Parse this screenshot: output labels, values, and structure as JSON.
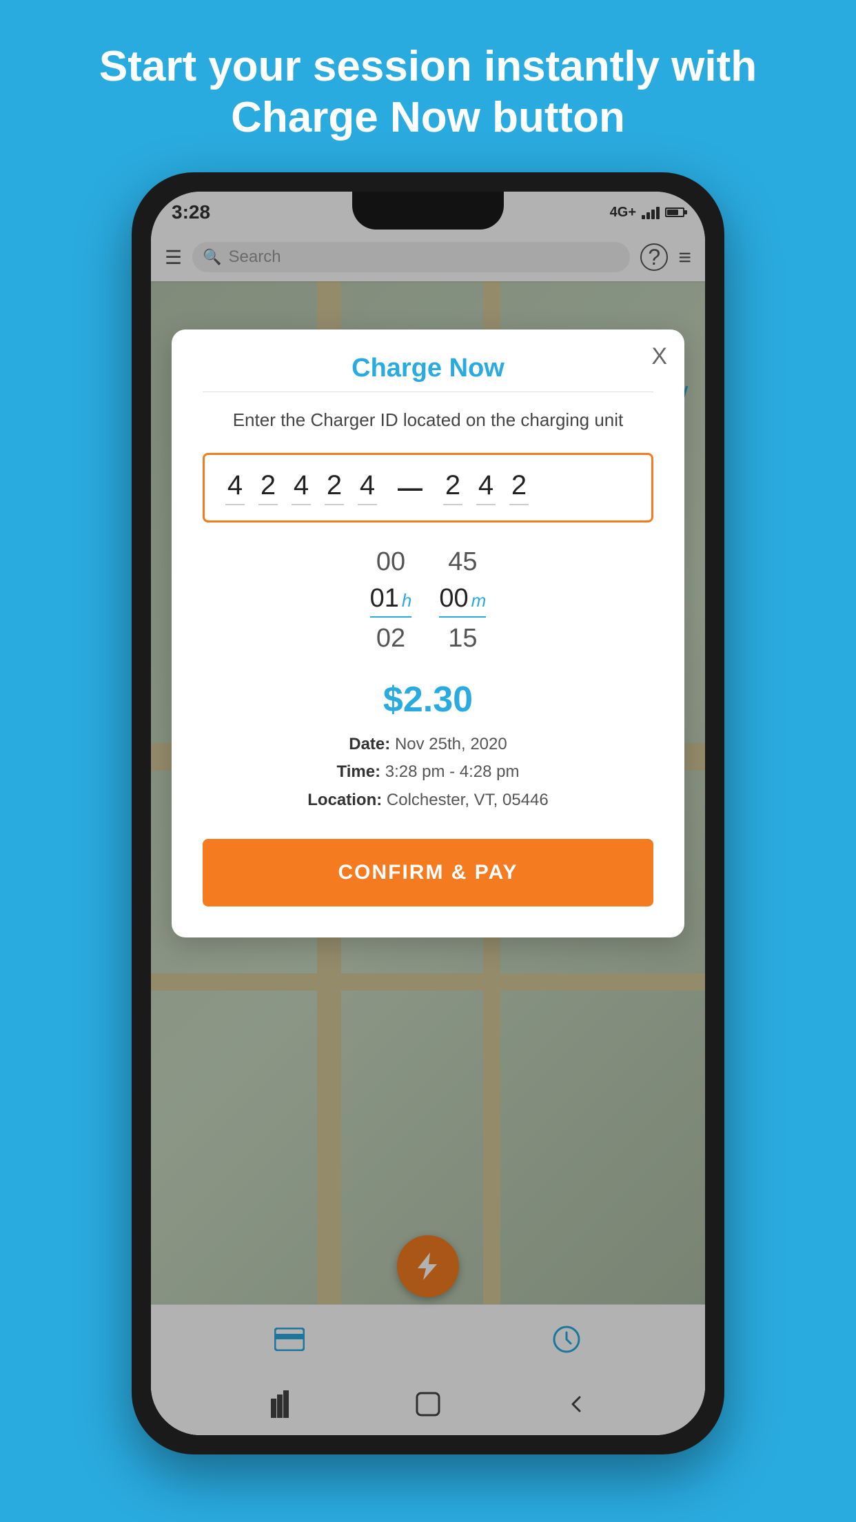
{
  "page": {
    "background_color": "#2AABE0",
    "headline": "Start your session instantly with Charge Now button"
  },
  "status_bar": {
    "time": "3:28",
    "network": "4G+",
    "signal_bars": 4,
    "battery_level": 65
  },
  "app_bar": {
    "search_placeholder": "Search",
    "menu_icon": "☰",
    "help_icon": "?",
    "filter_icon": "≡"
  },
  "map": {
    "chevron": "∨"
  },
  "app_tabs": {
    "tab1_icon": "card",
    "tab2_icon": "bolt",
    "tab3_icon": "clock"
  },
  "android_nav": {
    "back": "‹",
    "home": "○",
    "recent": "|||"
  },
  "modal": {
    "title": "Charge Now",
    "close_label": "X",
    "subtitle": "Enter the Charger ID located on the charging unit",
    "charger_id": {
      "part1": [
        "4",
        "2",
        "4",
        "2",
        "4"
      ],
      "dash": "—",
      "part2": [
        "2",
        "4",
        "2"
      ]
    },
    "time_picker": {
      "left_values": [
        "00",
        "01",
        "02"
      ],
      "right_values": [
        "45",
        "00",
        "15"
      ],
      "selected_left_index": 1,
      "selected_right_index": 1,
      "left_unit": "h",
      "right_unit": "m"
    },
    "price": "$2.30",
    "date_label": "Date:",
    "date_value": "Nov 25th, 2020",
    "time_label": "Time:",
    "time_value": "3:28 pm - 4:28 pm",
    "location_label": "Location:",
    "location_value": "Colchester, VT, 05446",
    "confirm_button_label": "CONFIRM & PAY"
  }
}
